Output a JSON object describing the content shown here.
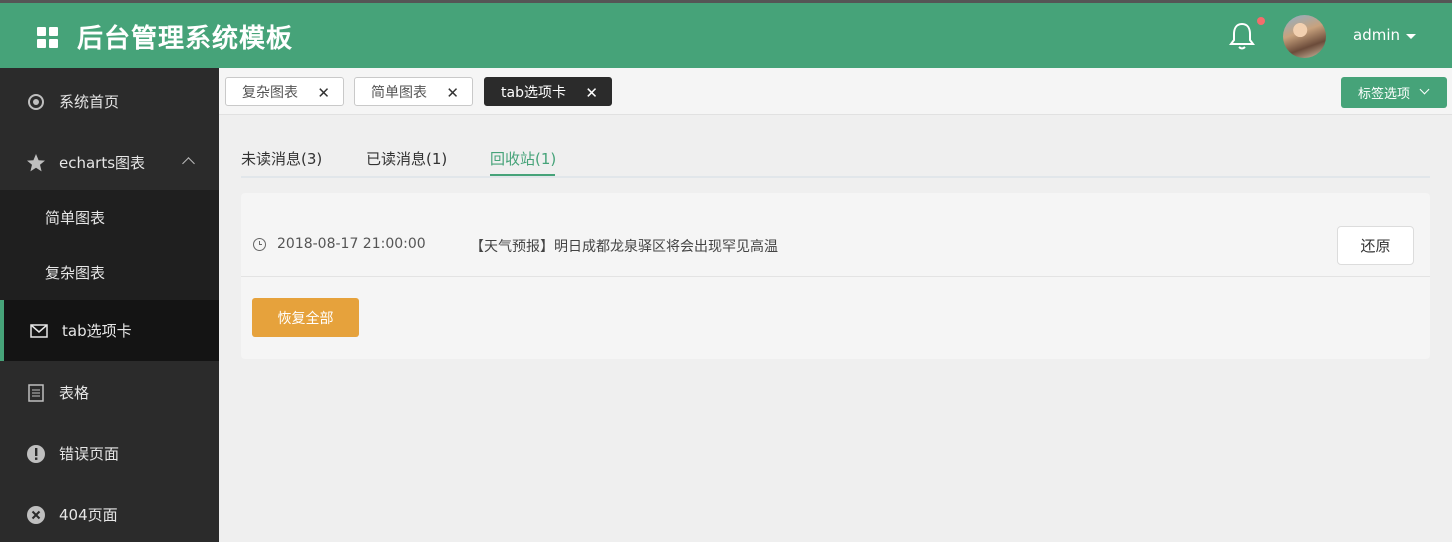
{
  "header": {
    "title": "后台管理系统模板",
    "user": "admin",
    "notification_badge": true,
    "accent_color": "#46a379"
  },
  "sidebar": {
    "items": [
      {
        "label": "系统首页",
        "icon": "dashboard-icon"
      },
      {
        "label": "echarts图表",
        "icon": "star-icon",
        "expanded": true,
        "children": [
          {
            "label": "简单图表"
          },
          {
            "label": "复杂图表"
          }
        ]
      },
      {
        "label": "tab选项卡",
        "icon": "mail-icon",
        "active": true
      },
      {
        "label": "表格",
        "icon": "document-icon"
      },
      {
        "label": "错误页面",
        "icon": "warning-icon"
      },
      {
        "label": "404页面",
        "icon": "close-circle-icon"
      }
    ]
  },
  "tags": {
    "items": [
      {
        "label": "复杂图表",
        "close": "✕"
      },
      {
        "label": "简单图表",
        "close": "✕"
      },
      {
        "label": "tab选项卡",
        "close": "✕",
        "active": true
      }
    ],
    "options_label": "标签选项"
  },
  "tabs": {
    "items": [
      {
        "label": "未读消息(3)"
      },
      {
        "label": "已读消息(1)"
      },
      {
        "label": "回收站(1)",
        "active": true
      }
    ]
  },
  "recycle": {
    "rows": [
      {
        "time": "2018-08-17 21:00:00",
        "message": "【天气预报】明日成都龙泉驿区将会出现罕见高温",
        "action": "还原"
      }
    ],
    "restore_all_label": "恢复全部",
    "restore_all_color": "#e6a23c"
  }
}
